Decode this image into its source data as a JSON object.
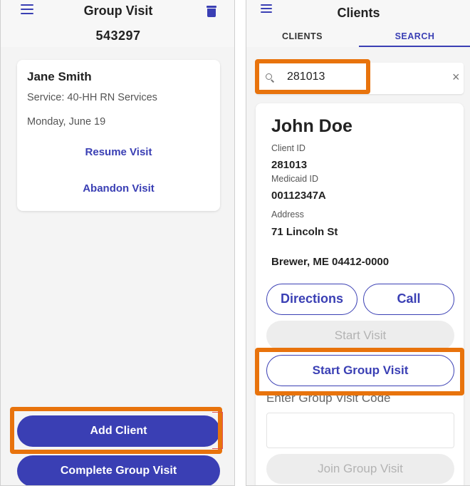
{
  "left_screen": {
    "header": {
      "title": "Group Visit",
      "code": "543297",
      "menu_icon": "hamburger-menu-icon",
      "trash_icon": "trash-icon"
    },
    "visit_card": {
      "client_name": "Jane Smith",
      "service": "Service: 40-HH RN Services",
      "date": "Monday, June 19",
      "resume_label": "Resume Visit",
      "abandon_label": "Abandon Visit"
    },
    "add_client_label": "Add Client",
    "complete_label": "Complete Group Visit"
  },
  "right_screen": {
    "header": {
      "title": "Clients",
      "menu_icon": "hamburger-menu-icon"
    },
    "tabs": [
      {
        "label": "CLIENTS",
        "active": false
      },
      {
        "label": "SEARCH",
        "active": true
      }
    ],
    "search": {
      "value": "281013",
      "icon": "search-icon",
      "clear_label": "×"
    },
    "client": {
      "name": "John Doe",
      "client_id_label": "Client ID",
      "client_id": "281013",
      "medicaid_id_label": "Medicaid ID",
      "medicaid_id": "00112347A",
      "address_label": "Address",
      "address_line1": "71 Lincoln St",
      "address_line2": "Brewer, ME 04412-0000"
    },
    "directions_label": "Directions",
    "call_label": "Call",
    "start_visit_label": "Start Visit",
    "start_group_visit_label": "Start Group Visit",
    "group_code_label": "Enter Group Visit Code",
    "group_code_value": "",
    "join_group_visit_label": "Join Group Visit"
  },
  "colors": {
    "accent": "#3a3fb4",
    "highlight": "#e8730c",
    "disabled_bg": "#ededed",
    "disabled_text": "#b3b3b3"
  }
}
